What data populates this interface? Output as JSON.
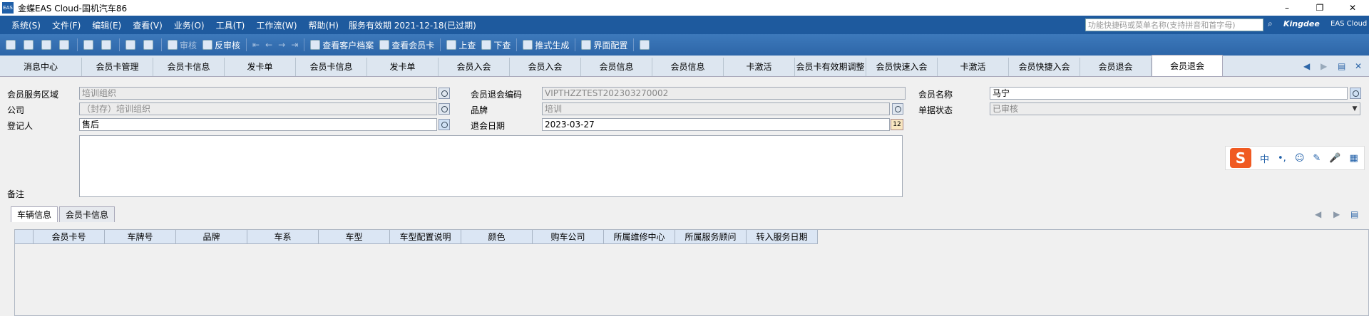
{
  "window": {
    "title": "金蝶EAS Cloud-国机汽车86",
    "app_icon_text": "EAS",
    "minimize": "–",
    "maximize": "❐",
    "close": "✕"
  },
  "menubar": {
    "items": [
      "系统(S)",
      "文件(F)",
      "编辑(E)",
      "查看(V)",
      "业务(O)",
      "工具(T)",
      "工作流(W)",
      "帮助(H)"
    ],
    "expire": "服务有效期 2021-12-18(已过期)",
    "search_placeholder": "功能快捷码或菜单名称(支持拼音和首字母)",
    "brand": "Kingdee",
    "brand_sub": "EAS Cloud"
  },
  "toolbar": {
    "audit": "审核",
    "unaudit": "反审核",
    "view_customer": "查看客户档案",
    "view_member_card": "查看会员卡",
    "prev_query": "上查",
    "next_query": "下查",
    "push": "推式生成",
    "ui_config": "界面配置"
  },
  "tabs": [
    "消息中心",
    "会员卡管理",
    "会员卡信息",
    "发卡单",
    "会员卡信息",
    "发卡单",
    "会员入会",
    "会员入会",
    "会员信息",
    "会员信息",
    "卡激活",
    "会员卡有效期调整",
    "会员快速入会",
    "卡激活",
    "会员快捷入会",
    "会员退会",
    "会员退会"
  ],
  "form": {
    "service_area_label": "会员服务区域",
    "service_area_value": "培训组织",
    "company_label": "公司",
    "company_value": "（封存）培训组织",
    "registrant_label": "登记人",
    "registrant_value": "售后",
    "remark_label": "备注",
    "exit_code_label": "会员退会编码",
    "exit_code_value": "VIPTHZZTEST202303270002",
    "brand_label": "品牌",
    "brand_value": "培训",
    "exit_date_label": "退会日期",
    "exit_date_value": "2023-03-27",
    "member_name_label": "会员名称",
    "member_name_value": "马宁",
    "bill_status_label": "单据状态",
    "bill_status_value": "已审核"
  },
  "ime": {
    "logo": "S",
    "mode": "中",
    "punct": "•,",
    "emoji": "☺",
    "pen": "✎",
    "mic": "🎤",
    "grid": "▦"
  },
  "subtabs": [
    "车辆信息",
    "会员卡信息"
  ],
  "grid": {
    "columns": [
      "会员卡号",
      "车牌号",
      "品牌",
      "车系",
      "车型",
      "车型配置说明",
      "颜色",
      "购车公司",
      "所属维修中心",
      "所属服务顾问",
      "转入服务日期"
    ]
  }
}
